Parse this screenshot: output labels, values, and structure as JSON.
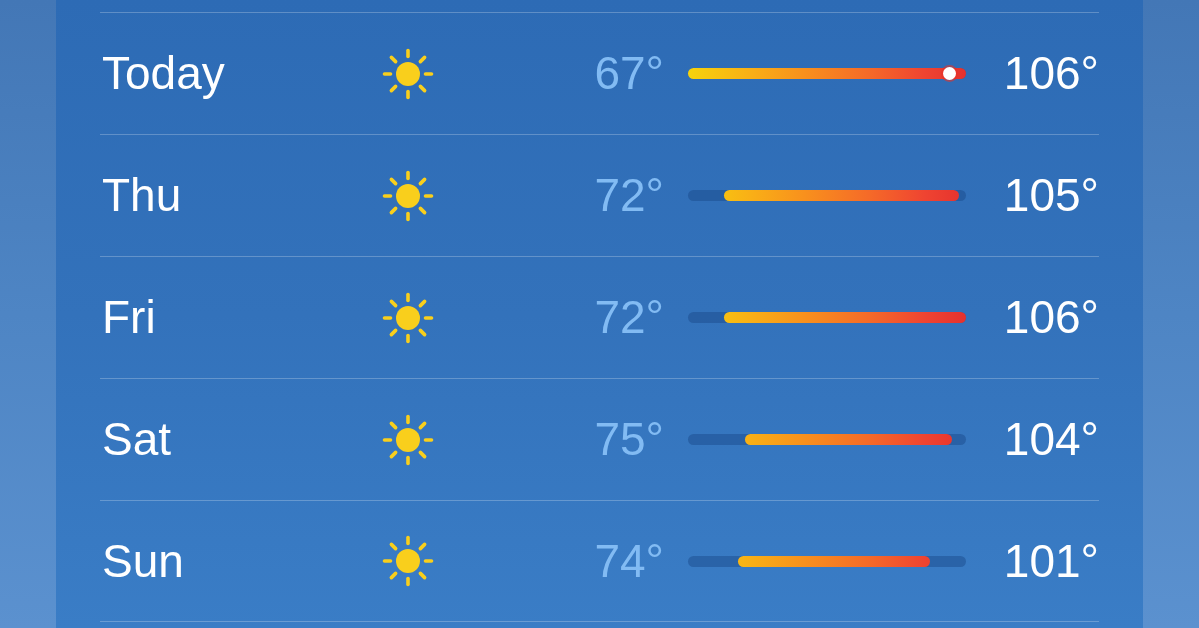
{
  "forecast": {
    "days": [
      {
        "day": "Today",
        "low": "67°",
        "high": "106°",
        "current": {
          "level": 0.94
        }
      },
      {
        "day": "Thu",
        "low": "72°",
        "high": "105°"
      },
      {
        "day": "Fri",
        "low": "72°",
        "high": "106°"
      },
      {
        "day": "Sat",
        "low": "75°",
        "high": "104°"
      },
      {
        "day": "Sun",
        "low": "74°",
        "high": "101°"
      }
    ]
  }
}
